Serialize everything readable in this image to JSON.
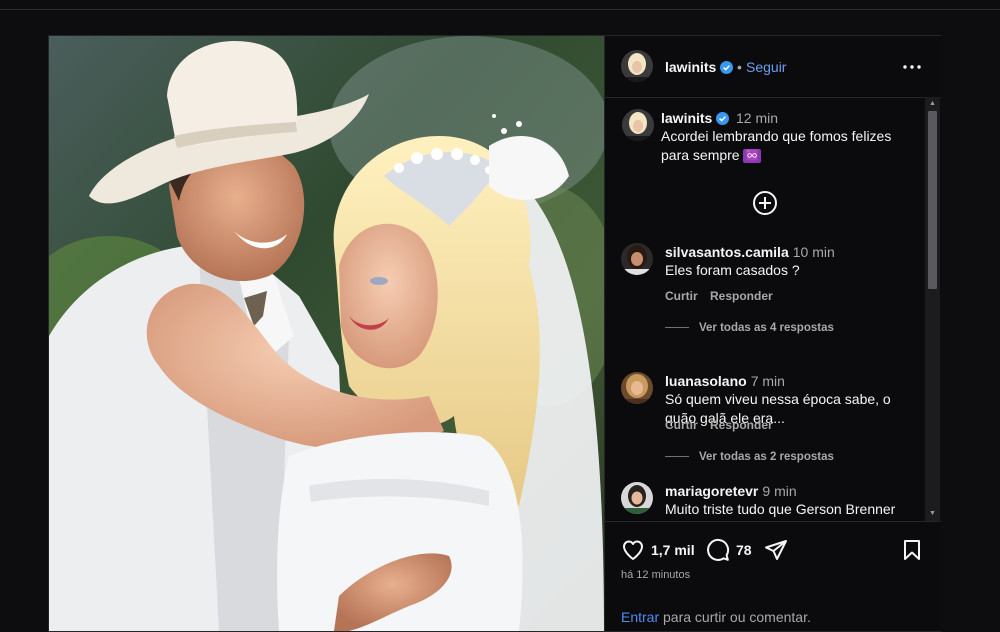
{
  "post": {
    "author": "lawinits",
    "follow_label": "Seguir",
    "separator": "•"
  },
  "caption": {
    "user": "lawinits",
    "time": "12 min",
    "text": "Acordei lembrando que fomos felizes para sempre",
    "emoji": "♾️"
  },
  "comments": [
    {
      "user": "silvasantos.camila",
      "time": "10 min",
      "text": "Eles foram casados ?",
      "like_label": "Curtir",
      "reply_label": "Responder",
      "view_replies": "Ver todas as 4 respostas"
    },
    {
      "user": "luanasolano",
      "time": "7 min",
      "text": "Só quem viveu nessa época sabe, o quão galã ele era...",
      "like_label": "Curtir",
      "reply_label": "Responder",
      "view_replies": "Ver todas as 2 respostas"
    },
    {
      "user": "mariagoretevr",
      "time": "9 min",
      "text": "Muito triste tudo que Gerson Brenner"
    }
  ],
  "actions": {
    "likes": "1,7 mil",
    "comments": "78",
    "posted_ago": "há 12 minutos",
    "login_link": "Entrar",
    "login_text": " para curtir ou comentar."
  },
  "icons": {
    "like": "heart-icon",
    "comment": "comment-bubble-icon",
    "share": "paper-plane-icon",
    "save": "bookmark-icon",
    "more": "more-options-icon",
    "add": "plus-circle-icon",
    "verified": "verified-badge-icon"
  },
  "colors": {
    "background": "#0b0b0e",
    "link": "#6a9ff0",
    "verified": "#3897f0",
    "muted": "#a8a8a8"
  }
}
